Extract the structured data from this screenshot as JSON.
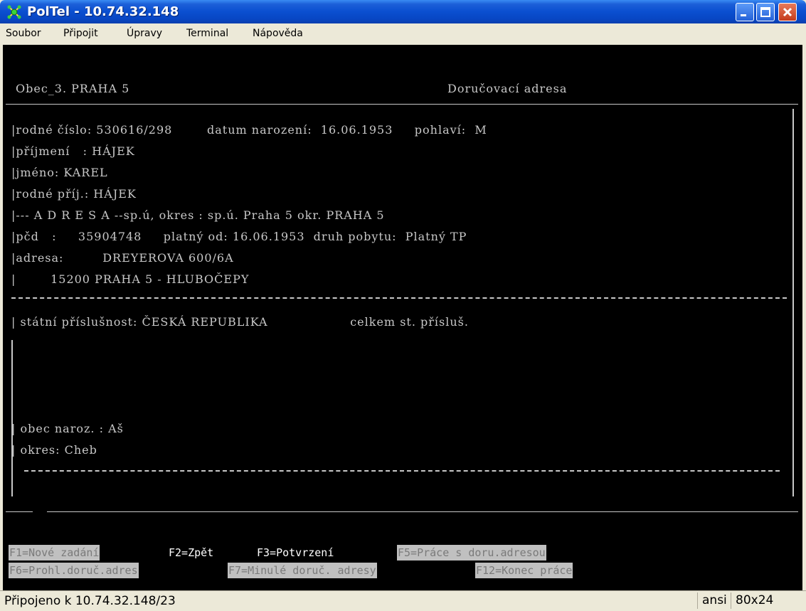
{
  "window": {
    "title": "PolTel - 10.74.32.148",
    "controls": [
      "minimize-icon",
      "maximize-icon",
      "close-icon"
    ]
  },
  "menu": {
    "items": [
      "Soubor",
      "Připojit",
      "Úpravy",
      "Terminal",
      "Nápověda"
    ]
  },
  "terminal": {
    "header_left": "Obec_3. PRAHA 5",
    "header_right": "Doručovací adresa",
    "lines": [
      "|rodné číslo: 530616/298        datum narození:  16.06.1953     pohlaví:  M",
      "|příjmení   : HÁJEK",
      "|jméno: KAREL",
      "|rodné příj.: HÁJEK",
      "|--- A D R E S A --sp.ú, okres : sp.ú. Praha 5 okr. PRAHA 5",
      "|pčd   :     35904748     platný od: 16.06.1953  druh pobytu:  Platný TP",
      "|adresa:         DREYEROVA 600/6A",
      "|        15200 PRAHA 5 - HLUBOČEPY",
      "| státní příslušnost: ČESKÁ REPUBLIKA                   celkem st. přísluš.",
      "| obec naroz. : Aš",
      "| okres: Cheb"
    ],
    "function_keys": {
      "f1": "F1=Nové zadání",
      "f2": "F2=Zpět",
      "f3": "F3=Potvrzení",
      "f5": "F5=Práce s doru.adresou",
      "f6": "F6=Prohl.doruč.adres",
      "f7": "F7=Minulé doruč. adresy",
      "f12": "F12=Konec práce"
    }
  },
  "status": {
    "connection": "Připojeno k 10.74.32.148/23",
    "encoding": "ansi",
    "size": "80x24"
  },
  "colors": {
    "titlebar": "#0a4fd0",
    "terminal_bg": "#000000",
    "terminal_fg": "#c8c8c8",
    "close_button": "#c43c1c"
  }
}
